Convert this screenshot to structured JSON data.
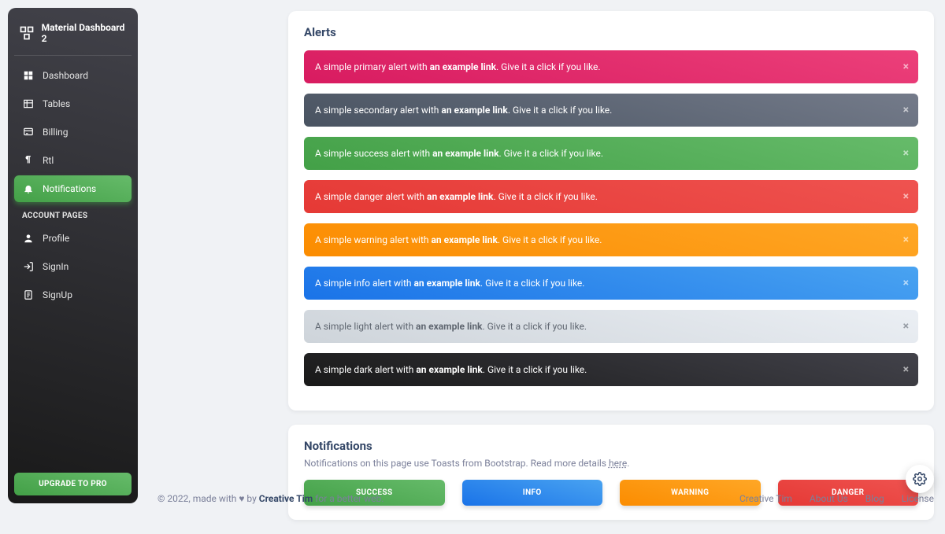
{
  "brand": {
    "title": "Material Dashboard 2"
  },
  "sidebar": {
    "items": [
      {
        "label": "Dashboard"
      },
      {
        "label": "Tables"
      },
      {
        "label": "Billing"
      },
      {
        "label": "Rtl"
      },
      {
        "label": "Notifications"
      }
    ],
    "section_label": "ACCOUNT PAGES",
    "account_items": [
      {
        "label": "Profile"
      },
      {
        "label": "SignIn"
      },
      {
        "label": "SignUp"
      }
    ],
    "upgrade_label": "UPGRADE TO PRO"
  },
  "alerts_card": {
    "title": "Alerts",
    "link_text": "an example link",
    "trail": ". Give it a click if you like.",
    "items": [
      {
        "pre": "A simple primary alert with ",
        "cls": "a-primary"
      },
      {
        "pre": "A simple secondary alert with ",
        "cls": "a-secondary"
      },
      {
        "pre": "A simple success alert with ",
        "cls": "a-success"
      },
      {
        "pre": "A simple danger alert with ",
        "cls": "a-danger"
      },
      {
        "pre": "A simple warning alert with ",
        "cls": "a-warning"
      },
      {
        "pre": "A simple info alert with ",
        "cls": "a-info"
      },
      {
        "pre": "A simple light alert with ",
        "cls": "a-light"
      },
      {
        "pre": "A simple dark alert with ",
        "cls": "a-dark"
      }
    ]
  },
  "notif_card": {
    "title": "Notifications",
    "subtitle_pre": "Notifications on this page use Toasts from Bootstrap. Read more details ",
    "subtitle_link": "here",
    "subtitle_post": ".",
    "buttons": [
      {
        "label": "SUCCESS",
        "cls": "b-success"
      },
      {
        "label": "INFO",
        "cls": "b-info"
      },
      {
        "label": "WARNING",
        "cls": "b-warning"
      },
      {
        "label": "DANGER",
        "cls": "b-danger"
      }
    ]
  },
  "footer": {
    "copyright_pre": "© 2022, made with ",
    "heart": "♥",
    "by": " by ",
    "author": "Creative Tim",
    "trail": " for a better web.",
    "links": [
      "Creative Tim",
      "About Us",
      "Blog",
      "License"
    ]
  }
}
